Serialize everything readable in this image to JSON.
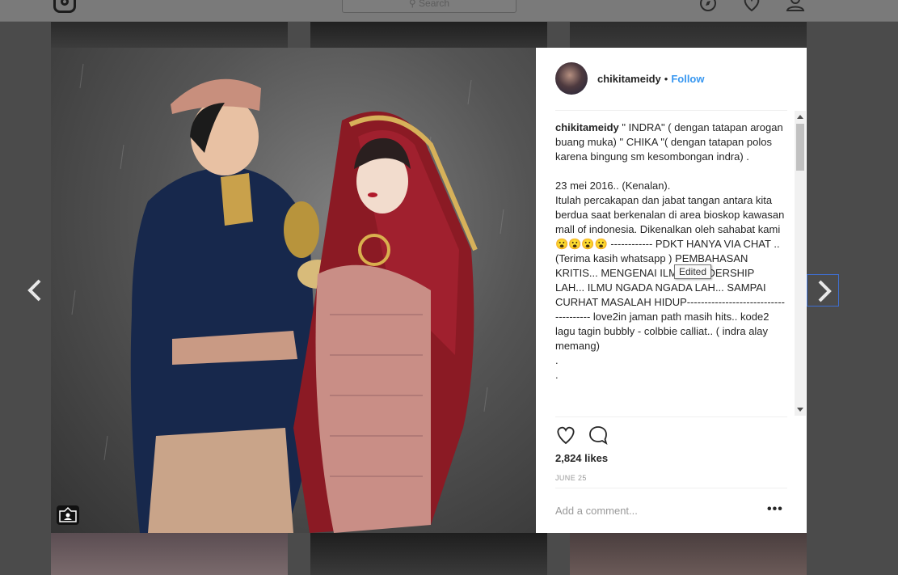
{
  "topbar": {
    "search_placeholder": "Search",
    "icons": [
      "instagram-logo-icon",
      "search-icon",
      "compass-icon",
      "heart-icon",
      "user-icon"
    ]
  },
  "post": {
    "username": "chikitameidy",
    "separator": "•",
    "follow_label": "Follow",
    "caption_user": "chikitameidy",
    "caption_text": " \" INDRA\" ( dengan tatapan arogan buang muka) \" CHIKA \"( dengan tatapan polos karena bingung sm kesombongan indra) .\n\n23 mei 2016.. (Kenalan).\nItulah percakapan dan jabat tangan antara kita berdua saat berkenalan di area bioskop kawasan mall of indonesia. Dikenalkan oleh sahabat kami 😮😮😮😮 ------------ PDKT HANYA VIA CHAT .. (Terima kasih whatsapp ) PEMBAHASAN KRITIS... MENGENAI ILMU LEADERSHIP LAH... ILMU NGADA NGADA LAH... SAMPAI CURHAT MASALAH HIDUP-------------------------------------- love2in jaman path masih hits.. kode2 lagu tagin bubbly - colbbie calliat.. ( indra alay memang)\n.\n.",
    "tooltip": "Edited",
    "likes": "2,824 likes",
    "date": "JUNE 25",
    "comment_placeholder": "Add a comment...",
    "more_label": "•••"
  },
  "colors": {
    "follow": "#3897f0",
    "text": "#262626",
    "muted": "#999999",
    "overlay": "#4b4b4b"
  }
}
